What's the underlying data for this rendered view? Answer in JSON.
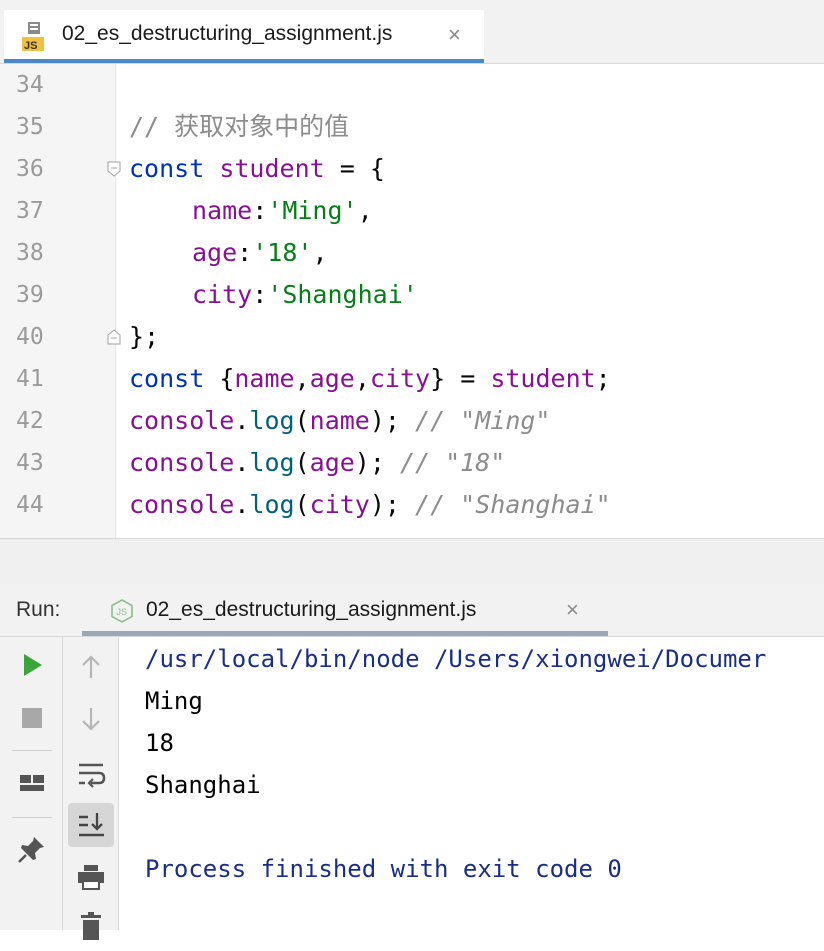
{
  "editor_tab": {
    "label": "02_es_destructuring_assignment.js",
    "close": "×",
    "icon": "js-file-icon"
  },
  "code_lines": [
    {
      "num": "34"
    },
    {
      "num": "35",
      "comment": "// 获取对象中的值"
    },
    {
      "num": "36",
      "kw": "const",
      "name": "student",
      "rest": " = {"
    },
    {
      "num": "37",
      "prop": "name",
      "colon": ":",
      "str": "'Ming'",
      "end": ","
    },
    {
      "num": "38",
      "prop": "age",
      "colon": ":",
      "str": "'18'",
      "end": ","
    },
    {
      "num": "39",
      "prop": "city",
      "colon": ":",
      "str": "'Shanghai'",
      "end": ""
    },
    {
      "num": "40",
      "text": "};"
    },
    {
      "num": "41",
      "kw": "const",
      "open": " {",
      "a": "name",
      "c1": ",",
      "b": "age",
      "c2": ",",
      "d": "city",
      "close": "} = ",
      "obj": "student",
      "semi": ";"
    },
    {
      "num": "42",
      "obj": "console",
      "dot": ".",
      "fn": "log",
      "po": "(",
      "arg": "name",
      "pc": "); ",
      "comment": "// \"Ming\""
    },
    {
      "num": "43",
      "obj": "console",
      "dot": ".",
      "fn": "log",
      "po": "(",
      "arg": "age",
      "pc": "); ",
      "comment": "// \"18\""
    },
    {
      "num": "44",
      "obj": "console",
      "dot": ".",
      "fn": "log",
      "po": "(",
      "arg": "city",
      "pc": "); ",
      "comment": "// \"Shanghai\""
    }
  ],
  "run_panel": {
    "label": "Run:",
    "tab_label": "02_es_destructuring_assignment.js",
    "tab_close": "×",
    "tab_icon": "nodejs-icon"
  },
  "console_output": {
    "command": "/usr/local/bin/node /Users/xiongwei/Documer",
    "lines": [
      "Ming",
      "18",
      "Shanghai"
    ],
    "exit_message": "Process finished with exit code 0"
  },
  "colors": {
    "keyword": "#0033b3",
    "variable": "#871094",
    "string": "#067d17",
    "comment": "#8c8c8c",
    "run_green": "#3aa53a",
    "tab_underline": "#4a88c7"
  }
}
